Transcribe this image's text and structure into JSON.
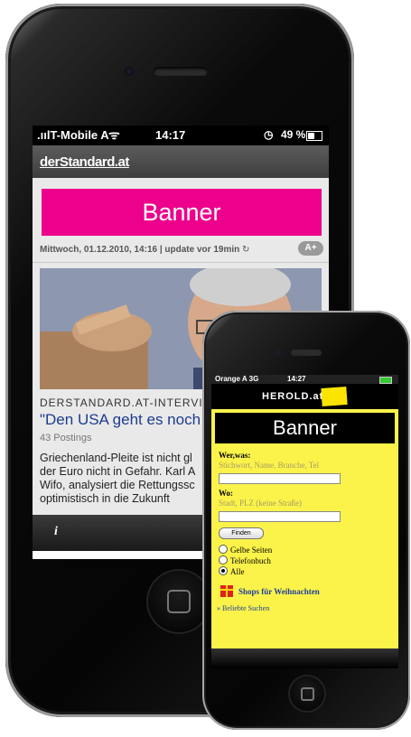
{
  "phone_large": {
    "status": {
      "carrier": ".ıılT-Mobile A",
      "wifi": "ᯤ",
      "time": "14:17",
      "alarm": "◷",
      "battery": "49 %"
    },
    "site_logo": "derStandard.at",
    "banner": "Banner",
    "dateline": "Mittwoch, 01.12.2010, 14:16 | update vor 19min",
    "reload_icon": "↻",
    "font_size_button": "A+",
    "article": {
      "kicker": "DERSTANDARD.AT-INTERVIEW",
      "title": "\"Den USA geht es noch v",
      "postings": "43 Postings",
      "teaser_lines": [
        "Griechenland-Pleite ist nicht gl",
        "der Euro nicht in Gefahr. Karl A",
        "Wifo, analysiert die Rettungssc",
        "optimistisch in die Zukunft"
      ]
    },
    "info_icon": "i"
  },
  "phone_small": {
    "status": {
      "carrier": "Orange A 3G",
      "time": "14:27"
    },
    "site_logo": "HEROLD.at",
    "banner": "Banner",
    "search": {
      "what_label": "Wer,was:",
      "what_placeholder": "Stichwort, Name, Branche, Tel",
      "where_label": "Wo:",
      "where_placeholder": "Stadt, PLZ (keine Straße)",
      "find_button": "Finden"
    },
    "options": [
      {
        "label": "Gelbe Seiten",
        "selected": false
      },
      {
        "label": "Telefonbuch",
        "selected": false
      },
      {
        "label": "Alle",
        "selected": true
      }
    ],
    "shops_link": "Shops für Weihnachten",
    "popular_link": "» Beliebte Suchen"
  }
}
